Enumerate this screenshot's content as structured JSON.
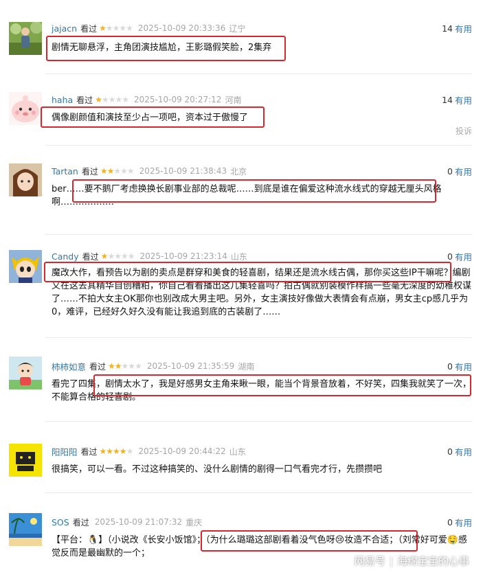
{
  "reviews": [
    {
      "user": "jajacn",
      "watched": "看过",
      "stars_on": "★",
      "stars_off": "★★★★",
      "time": "2025-10-09 20:33:36",
      "location": "辽宁",
      "votes": "14",
      "useful": "有用",
      "text": "剧情无聊悬浮，主角团演技尴尬，王影璐假笑脸，2集弃"
    },
    {
      "user": "haha",
      "watched": "看过",
      "stars_on": "★",
      "stars_off": "★★★★",
      "time": "2025-10-09 20:27:12",
      "location": "河南",
      "votes": "14",
      "useful": "有用",
      "text": "偶像剧颜值和演技至少占一项吧，资本过于傲慢了",
      "report": "投诉"
    },
    {
      "user": "Tartan",
      "watched": "看过",
      "stars_on": "★★",
      "stars_off": "★★★",
      "time": "2025-10-09 21:38:43",
      "location": "北京",
      "votes": "0",
      "useful": "有用",
      "text": "ber……要不鹅厂考虑换换长剧事业部的总裁呢……到底是谁在偏爱这种流水线式的穿越无厘头风格啊………………"
    },
    {
      "user": "Candy",
      "watched": "看过",
      "stars_on": "★",
      "stars_off": "★★★★",
      "time": "2025-10-09 21:23:14",
      "location": "山东",
      "votes": "0",
      "useful": "有用",
      "text": "魔改大作，看预告以为剧的卖点是群穿和美食的轻喜剧，结果还是流水线古偶，那你买这些IP干嘛呢？编剧又在这去其精华自创糟粕，你自己看看播出这几集轻喜吗？拍古偶就别装模作样搞一些毫无深度的幼稚权谋了……不拍大女主OK那你也别改成大男主吧。另外，女主演技好像做大表情会有点崩，男女主cp感几乎为0，难评，已经好久好久没有能让我追到底的古装剧了……"
    },
    {
      "user": "柿柿如意",
      "watched": "看过",
      "stars_on": "★★",
      "stars_off": "★★★",
      "time": "2025-10-09 21:35:59",
      "location": "湖南",
      "votes": "0",
      "useful": "有用",
      "text": "看完了四集，剧情太水了，我是好感男女主角来瞅一眼，能当个背景音放着，不好笑，四集我就笑了一次，不能算合格的轻喜剧。"
    },
    {
      "user": "阳阳阳",
      "watched": "看过",
      "stars_on": "★★★★",
      "stars_off": "★",
      "time": "2025-10-09 20:44:22",
      "location": "山东",
      "votes": "0",
      "useful": "有用",
      "text": "很搞笑，可以一看。不过这种搞笑的、没什么剧情的剧得一口气看完才行，先攒攒吧"
    },
    {
      "user": "SOS",
      "watched": "看过",
      "stars_on": "",
      "stars_off": "",
      "time": "2025-10-09 21:07:32",
      "location": "重庆",
      "votes": "0",
      "useful": "有用",
      "text": "【平台：🐧】（小说改《长安小饭馆》；（为什么璐璐这部剧看着没气色呀😢妆造不合适；（刘常好可爱🤤感觉反而是最幽默的一个；"
    }
  ],
  "watermark": {
    "brand": "网易号",
    "sep": "|",
    "author": "海绵宝宝的心事"
  },
  "colors": {
    "username": "#3377aa",
    "star_on": "#f5b11e",
    "star_off": "#d9d9d9",
    "highlight": "#d8262c",
    "meta_gray": "#a6a6a6"
  }
}
